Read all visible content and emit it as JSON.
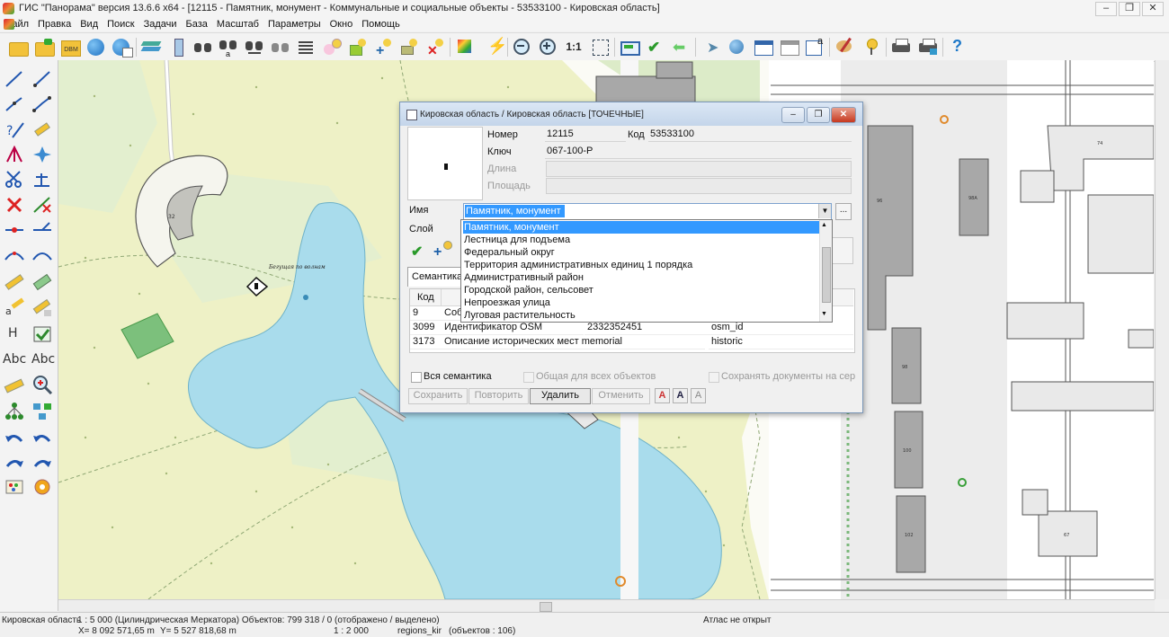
{
  "window": {
    "title": "ГИС \"Панорама\" версия 13.6.6 x64 - [12115 - Памятник, монумент - Коммунальные и социальные объекты - 53533100 - Кировская область]",
    "minimize": "–",
    "maximize": "❐",
    "close": "✕"
  },
  "menu": [
    "Файл",
    "Правка",
    "Вид",
    "Поиск",
    "Задачи",
    "База",
    "Масштаб",
    "Параметры",
    "Окно",
    "Помощь"
  ],
  "toolbar": {
    "zoom_label": "1:1",
    "icons": [
      "open-folder-icon",
      "open-folder-icon",
      "dbm-icon",
      "globe-icon",
      "globe-icon",
      "layers-icon",
      "measure-icon",
      "binoculars-icon",
      "binoculars-text-icon",
      "binoculars-icon",
      "binoculars-icon",
      "list-icon",
      "select-object-icon",
      "select-object-icon",
      "add-object-icon",
      "select-object-icon",
      "delete-object-icon",
      "cube-icon",
      "lightning-icon",
      "zoom-out-icon",
      "zoom-in-icon",
      "zoom-1to1-icon",
      "fit-frame-icon",
      "frame-icon",
      "check-icon",
      "arrow-left-icon",
      "pointer-icon",
      "globe-pointer-icon",
      "window-icon",
      "window-icon",
      "text-icon",
      "paint-icon",
      "pin-icon",
      "printer-icon",
      "printer-icon",
      "help-icon"
    ]
  },
  "left_toolbar": {
    "h_label": "H",
    "abc_label_1": "Abc",
    "abc_label_2": "Abc"
  },
  "map": {
    "labels": {
      "pond_label": "Бегущая по волнам",
      "b32": "32",
      "b74": "74",
      "b98": "98",
      "b98a": "98А",
      "b100": "100",
      "b102": "102",
      "b67": "67",
      "b96": "96"
    }
  },
  "dialog": {
    "title": "Кировская область / Кировская область [ТОЧЕЧНЫЕ]",
    "number_label": "Номер",
    "number_value": "12115",
    "code_label": "Код",
    "code_value": "53533100",
    "key_label": "Ключ",
    "key_value": "067-100-P",
    "length_label": "Длина",
    "area_label": "Площадь",
    "name_label": "Имя",
    "name_value": "Памятник, монумент",
    "layer_label": "Слой",
    "dots": "...",
    "tab_semantics": "Семантика",
    "dropdown_items": [
      "Памятник, монумент",
      "Лестница для подъема",
      "Федеральный округ",
      "Территория административных единиц 1 порядка",
      "Административный район",
      "Городской район, сельсовет",
      "Непроезжая улица",
      "Луговая растительность"
    ],
    "table_headers": [
      "Код",
      "",
      "",
      ""
    ],
    "table_rows": [
      {
        "code": "9",
        "name": "Соб",
        "value": "",
        "key": ""
      },
      {
        "code": "3099",
        "name": "Идентификатор OSM",
        "value": "2332352451",
        "key": "osm_id"
      },
      {
        "code": "3173",
        "name": "Описание исторических мест memorial",
        "value": "",
        "key": "historic"
      }
    ],
    "all_semantics": "Вся семантика",
    "common_for_all": "Общая для всех объектов",
    "save_docs": "Сохранять документы на сер",
    "btn_save": "Сохранить",
    "btn_repeat": "Повторить",
    "btn_delete": "Удалить",
    "btn_cancel": "Отменить",
    "font_a1": "A",
    "font_a2": "A",
    "font_a3": "A"
  },
  "status": {
    "region": "Кировская область",
    "scale": "1 : 5 000 (Цилиндрическая Меркатора) Объектов: 799 318 / 0 (отображено / выделено)",
    "atlas": "Атлас не открыт",
    "x": "X= 8 092 571,65 m",
    "y": "Y= 5 527 818,68 m",
    "scale2": "1 : 2 000",
    "layer": "regions_kir",
    "objects": "(объектов : 106)"
  },
  "colors": {
    "water": "#a9dcec",
    "forest": "#eef2c8",
    "meadow": "#dcedc8",
    "building": "#a8a8a8",
    "selection": "#3399ff"
  }
}
